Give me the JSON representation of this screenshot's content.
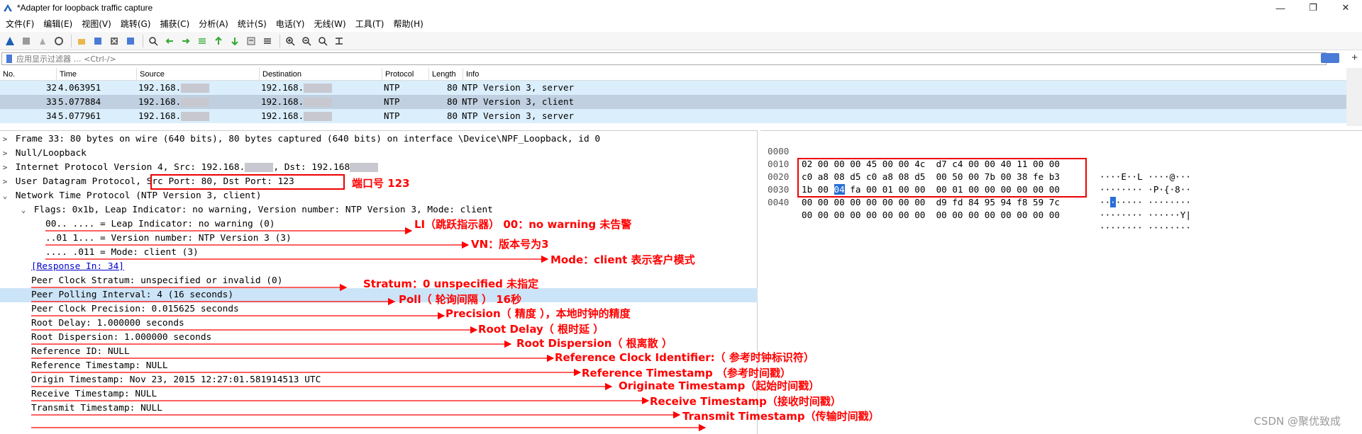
{
  "window": {
    "title": "*Adapter for loopback traffic capture",
    "controls": [
      "—",
      "❐",
      "✕"
    ]
  },
  "menu": [
    "文件(F)",
    "编辑(E)",
    "视图(V)",
    "跳转(G)",
    "捕获(C)",
    "分析(A)",
    "统计(S)",
    "电话(Y)",
    "无线(W)",
    "工具(T)",
    "帮助(H)"
  ],
  "filter": {
    "placeholder": "应用显示过滤器 … <Ctrl-/>",
    "plus": "+"
  },
  "packet_list": {
    "headers": [
      "No.",
      "Time",
      "Source",
      "Destination",
      "Protocol",
      "Length",
      "Info"
    ],
    "rows": [
      {
        "no": "32",
        "time": "4.063951",
        "src": "192.168.",
        "dst": "192.168.",
        "proto": "NTP",
        "len": "80",
        "info": "NTP Version 3, server"
      },
      {
        "no": "33",
        "time": "5.077884",
        "src": "192.168.",
        "dst": "192.168.",
        "proto": "NTP",
        "len": "80",
        "info": "NTP Version 3, client"
      },
      {
        "no": "34",
        "time": "5.077961",
        "src": "192.168.",
        "dst": "192.168.",
        "proto": "NTP",
        "len": "80",
        "info": "NTP Version 3, server"
      }
    ]
  },
  "details": {
    "frame": "Frame 33: 80 bytes on wire (640 bits), 80 bytes captured (640 bits) on interface \\Device\\NPF_Loopback, id 0",
    "null": "Null/Loopback",
    "ip": "Internet Protocol Version 4, Src: 192.168.",
    "ip_dst": ", Dst: 192.168",
    "udp": "User Datagram Protocol, ",
    "udp_ports": "Src Port: 80, Dst Port: 123",
    "ntp": "Network Time Protocol (NTP Version 3, client)",
    "flags": "Flags: 0x1b, Leap Indicator: no warning, Version number: NTP Version 3, Mode: client",
    "li": "00.. .... = Leap Indicator: no warning (0)",
    "vn": "..01 1... = Version number: NTP Version 3 (3)",
    "mode": ".... .011 = Mode: client (3)",
    "response": "[Response In: 34]",
    "stratum": "Peer Clock Stratum: unspecified or invalid (0)",
    "poll": "Peer Polling Interval: 4 (16 seconds)",
    "precision": "Peer Clock Precision: 0.015625 seconds",
    "root_delay": "Root Delay: 1.000000 seconds",
    "root_disp": "Root Dispersion: 1.000000 seconds",
    "ref_id": "Reference ID: NULL",
    "ref_ts": "Reference Timestamp: NULL",
    "orig_ts": "Origin Timestamp: Nov 23, 2015 12:27:01.581914513 UTC",
    "recv_ts": "Receive Timestamp: NULL",
    "xmit_ts": "Transmit Timestamp: NULL"
  },
  "hex": [
    {
      "off": "0000",
      "b1": "02 00 00 00 45 00 00 4c",
      "b2": "d7 c4 00 00 40 11 00 00",
      "ascii": "····E··L ····@···"
    },
    {
      "off": "0010",
      "b1": "c0 a8 08 d5 c0 a8 08 d5",
      "b2": "00 50 00 7b 00 38 fe b3",
      "ascii": "········ ·P·{·8··"
    },
    {
      "off": "0020",
      "b1a": "1b 00 ",
      "b1sel": "04",
      "b1b": " fa 00 01 00 00",
      "b2": "00 01 00 00 00 00 00 00",
      "ascii_a": "··",
      "ascii_sel": "·",
      "ascii_b": "····· ········"
    },
    {
      "off": "0030",
      "b1": "00 00 00 00 00 00 00 00",
      "b2": "d9 fd 84 95 94 f8 59 7c",
      "ascii": "········ ······Y|"
    },
    {
      "off": "0040",
      "b1": "00 00 00 00 00 00 00 00",
      "b2": "00 00 00 00 00 00 00 00",
      "ascii": "········ ········"
    }
  ],
  "annotations": {
    "port": "端口号 123",
    "li": "LI（跳跃指示器） 00：no warning 未告警",
    "vn": "VN：版本号为3",
    "mode": "Mode：client 表示客户模式",
    "stratum": "Stratum：0 unspecified  未指定",
    "poll": "Poll（ 轮询间隔 ） 16秒",
    "precision": "Precision（ 精度 ），本地时钟的精度",
    "root_delay": "Root Delay（ 根时延 ）",
    "root_disp": "Root Dispersion（ 根离散 ）",
    "ref_id": "Reference Clock Identifier:（ 参考时钟标识符）",
    "ref_ts": "Reference Timestamp （参考时间戳）",
    "orig_ts": "Originate Timestamp（起始时间戳）",
    "recv_ts": "Receive Timestamp（接收时间戳）",
    "xmit_ts": "Transmit Timestamp（传输时间戳）"
  },
  "watermark": "CSDN @聚优致成",
  "colors": {
    "annotation": "#ff0000",
    "row_bg": "#daeefb",
    "row_selected": "#c0d0e0",
    "detail_highlight": "#cce4f7",
    "byte_selected": "#2a6fd6"
  }
}
